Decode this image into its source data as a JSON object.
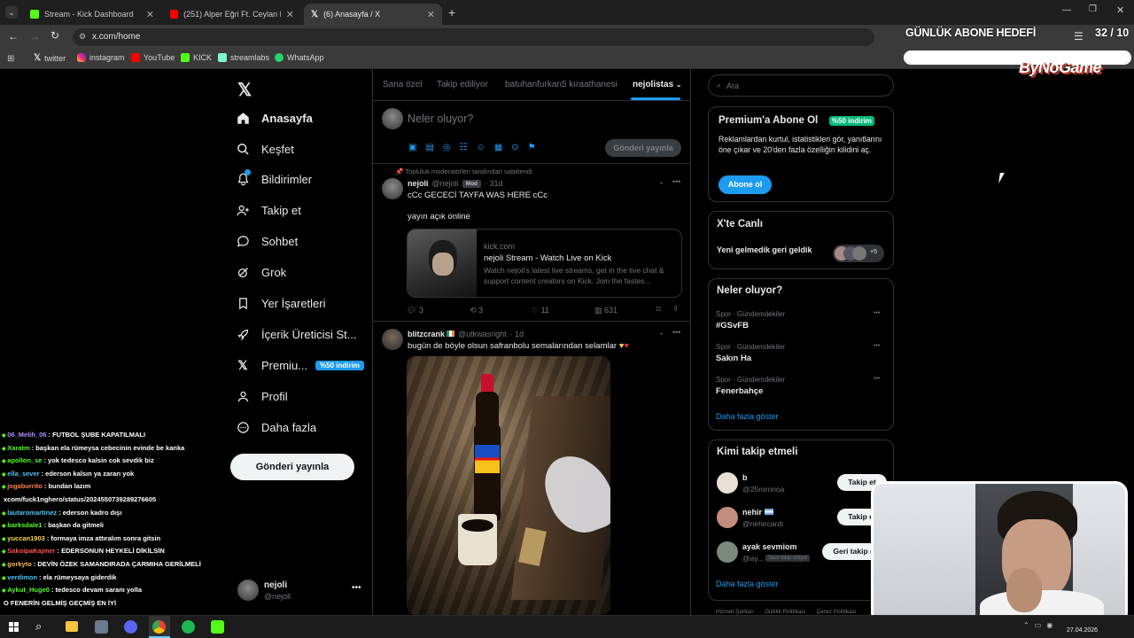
{
  "browser": {
    "tabs": [
      {
        "title": "Stream - Kick Dashboard",
        "active": false
      },
      {
        "title": "(251) Alper Eğri Ft. Ceylan Koyn",
        "active": false
      },
      {
        "title": "(6) Anasayfa / X",
        "active": true
      }
    ],
    "url": "x.com/home",
    "bookmarks": [
      "twitter",
      "instagram",
      "YouTube",
      "KICK",
      "streamlabs",
      "WhatsApp"
    ]
  },
  "overlay": {
    "goal_label": "GÜNLÜK ABONE HEDEFİ",
    "goal_count": "32 / 10",
    "brand": "ByNoGame",
    "goal_progress": 1.0
  },
  "sidebar": {
    "items": [
      {
        "label": "Anasayfa",
        "icon": "home-icon"
      },
      {
        "label": "Keşfet",
        "icon": "search-icon"
      },
      {
        "label": "Bildirimler",
        "icon": "bell-icon"
      },
      {
        "label": "Takip et",
        "icon": "follow-icon"
      },
      {
        "label": "Sohbet",
        "icon": "chat-icon"
      },
      {
        "label": "Grok",
        "icon": "grok-icon"
      },
      {
        "label": "Yer İşaretleri",
        "icon": "bookmark-icon"
      },
      {
        "label": "İçerik Üreticisi St...",
        "icon": "rocket-icon"
      },
      {
        "label": "Premiu...",
        "icon": "x-icon",
        "badge": "%50 indirim"
      },
      {
        "label": "Profil",
        "icon": "user-icon"
      },
      {
        "label": "Daha fazla",
        "icon": "more-icon"
      }
    ],
    "post_button": "Gönderi yayınla",
    "account_name": "nejoli",
    "account_handle": "@nejoli"
  },
  "feed": {
    "tabs": [
      "Sana özel",
      "Takip ediliyor",
      "batuhanfurkan5 kıraathanesi",
      "nejolistas"
    ],
    "compose_placeholder": "Neler oluyor?",
    "compose_button": "Gönderi yayınla",
    "pinned_label": "Topluluk moderatörleri tarafından sabitlendi",
    "post1": {
      "name": "nejoli",
      "handle": "@nejoli",
      "badge": "Mod",
      "time": "· 31d",
      "line1": "cCc GECECİ TAYFA WAS HERE cCc",
      "line2": "yayın açık online",
      "link_domain": "kick.com",
      "link_title": "nejoli Stream - Watch Live on Kick",
      "link_desc": "Watch nejoli's latest live streams, get in the live chat & support content creators on Kick. Join the fastes...",
      "replies": "3",
      "reposts": "3",
      "likes": "11",
      "views": "631"
    },
    "post2": {
      "name": "blitzcrank",
      "handle": "@utkwasright",
      "time": "· 1d",
      "text": "bugün de böyle olsun safranbolu semalarından selamlar"
    }
  },
  "right": {
    "search_placeholder": "Ara",
    "premium_title": "Premium'a Abone Ol",
    "premium_badge": "%50 indirim",
    "premium_text": "Reklamlardan kurtul, istatistikleri gör, yanıtlarını öne çıkar ve 20'den fazla özelliğin kilidini aç.",
    "premium_button": "Abone ol",
    "live_title": "X'te Canlı",
    "live_text": "Yeni gelmedik geri geldik",
    "live_count": "+5",
    "trends_title": "Neler oluyor?",
    "trends": [
      {
        "context": "Spor · Gündemdekiler",
        "name": "#GSvFB"
      },
      {
        "context": "Spor · Gündemdekiler",
        "name": "Sakın Ha"
      },
      {
        "context": "Spor · Gündemdekiler",
        "name": "Fenerbahçe"
      }
    ],
    "show_more": "Daha fazla göster",
    "who_title": "Kimi takip etmeli",
    "who": [
      {
        "name": "b",
        "handle": "@25roronoa",
        "button": "Takip et"
      },
      {
        "name": "nehir",
        "handle": "@nehircardi",
        "button": "Takip et"
      },
      {
        "name": "ayak sevmiom",
        "handle": "@ay...",
        "tag": "Seni takip ediyor",
        "button": "Geri takip et"
      }
    ],
    "footer": [
      "Hizmet Şartları",
      "Gizlilik Politikası",
      "Çerez Politikası"
    ]
  },
  "chat": [
    {
      "user": "06_Melih_06",
      "msg": ": FUTBOL ŞUBE KAPATILMALI",
      "color": "#b08cff"
    },
    {
      "user": "Xaratm",
      "msg": ": başkan ela rümeysa cebecinin evinde be kanka",
      "color": "#53fc18"
    },
    {
      "user": "apollon_se",
      "msg": ": yok tedesco kalsin cok sevdik biz",
      "color": "#53fc18"
    },
    {
      "user": "ella_sever",
      "msg": ": ederson kalsın ya zararı yok",
      "color": "#4fc3f7"
    },
    {
      "user": "jogaburrito",
      "msg": ": bundan lazım",
      "color": "#ff7f50"
    },
    {
      "user": "",
      "msg": "xcom/fuck1nghero/status/2024550739289276605",
      "color": "#ffffff"
    },
    {
      "user": "lautaromartinez",
      "msg": ": ederson kadro dışı",
      "color": "#4fc3f7"
    },
    {
      "user": "barksdale1",
      "msg": ": başkan da gitmeli",
      "color": "#53fc18"
    },
    {
      "user": "yuccan1903",
      "msg": ": formaya imza attıralım sonra gitsin",
      "color": "#ffd54f"
    },
    {
      "user": "SakoipaKajmer",
      "msg": ": EDERSONUN HEYKELİ DİKİLSİN",
      "color": "#ff5252"
    },
    {
      "user": "gorkyto",
      "msg": ": DEVİN ÖZEK SAMANDIRADA ÇARMIHA GERİLMELİ",
      "color": "#ffb74d"
    },
    {
      "user": "verdimon",
      "msg": ": ela rümeysaya giderdik",
      "color": "#4fc3f7"
    },
    {
      "user": "Aykut_Huge0",
      "msg": ": tedesco devam saranı yolla",
      "color": "#53fc18"
    },
    {
      "user": "",
      "msg": "O FENERİN GELMİŞ GEÇMİŞ EN İYİ",
      "color": "#ffffff"
    }
  ],
  "taskbar": {
    "date": "27.04.2026"
  }
}
